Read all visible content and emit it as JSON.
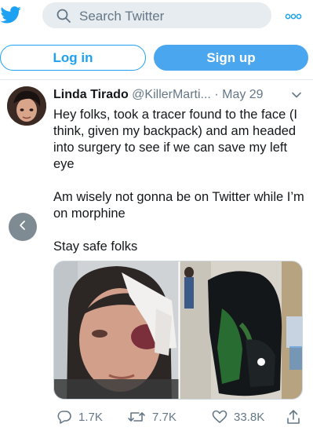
{
  "search": {
    "placeholder": "Search Twitter"
  },
  "auth": {
    "login_label": "Log in",
    "signup_label": "Sign up"
  },
  "tweet": {
    "author_name": "Linda Tirado",
    "author_handle": "@KillerMarti...",
    "separator": "·",
    "date": "May 29",
    "paragraphs": [
      "Hey folks, took a tracer found to the face (I think, given my backpack) and am headed into surgery to see if we can save my left eye",
      "Am wisely not gonna be on Twitter while I’m on morphine",
      "Stay safe folks"
    ],
    "stats": {
      "replies": "1.7K",
      "retweets": "7.7K",
      "likes": "33.8K"
    }
  },
  "icons": {
    "brand": "twitter-bird-icon",
    "search": "search-icon",
    "more": "more-icon",
    "chevron": "chevron-down-icon",
    "back": "chevron-left-icon",
    "reply": "reply-icon",
    "retweet": "retweet-icon",
    "like": "heart-icon",
    "share": "share-icon"
  },
  "colors": {
    "brand": "#1da1f2",
    "signup_bg": "#4aa6ee",
    "muted": "#657786"
  }
}
